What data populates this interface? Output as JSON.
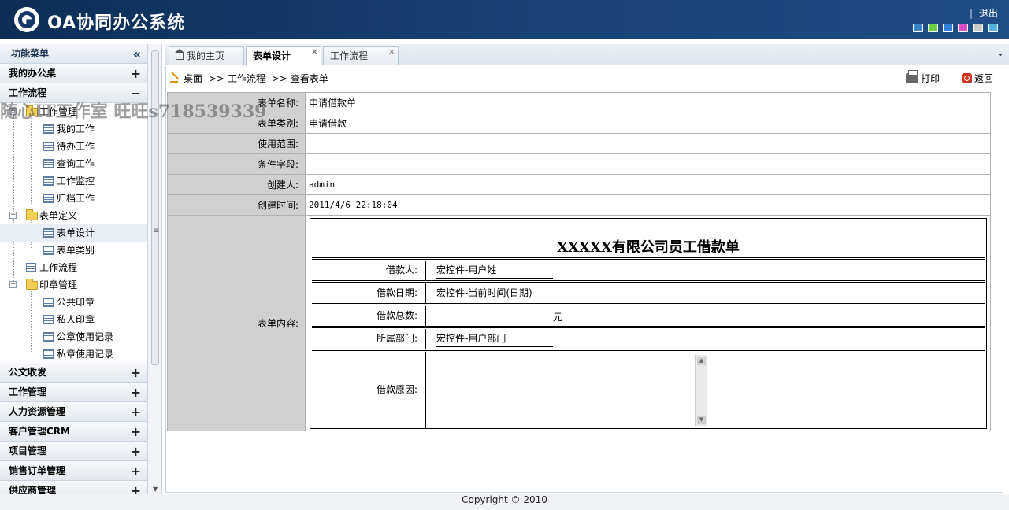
{
  "header": {
    "title": "OA协同办公系统",
    "logout": "退出",
    "swatch_colors": [
      "#3a82c9",
      "#6ccf44",
      "#2f7fd8",
      "#d64fc4",
      "#c9c9c9",
      "#4fb3e0"
    ]
  },
  "sidebar": {
    "title": "功能菜单",
    "top_categories": [
      "我的办公桌",
      "工作流程"
    ],
    "tree": {
      "g1": "工作管理",
      "g1_items": [
        "我的工作",
        "待办工作",
        "查询工作",
        "工作监控",
        "归档工作"
      ],
      "g2": "表单定义",
      "g2_items": [
        "表单设计",
        "表单类别"
      ],
      "workflow": "工作流程",
      "g3": "印章管理",
      "g3_items": [
        "公共印章",
        "私人印章",
        "公章使用记录",
        "私章使用记录"
      ]
    },
    "bottom_categories": [
      "公文收发",
      "工作管理",
      "人力资源管理",
      "客户管理CRM",
      "项目管理",
      "销售订单管理",
      "供应商管理"
    ]
  },
  "tabs": [
    "我的主页",
    "表单设计",
    "工作流程"
  ],
  "breadcrumb": {
    "desktop": "桌面",
    "sep": ">>",
    "workflow": "工作流程",
    "view": "查看表单",
    "print": "打印",
    "back": "返回"
  },
  "form": {
    "labels": [
      "表单名称:",
      "表单类别:",
      "使用范围:",
      "条件字段:",
      "创建人:",
      "创建时间:",
      "表单内容:"
    ],
    "values": [
      "申请借款单",
      "申请借款",
      "",
      "",
      "admin",
      "2011/4/6 22:18:04"
    ]
  },
  "content_form": {
    "title": "XXXXX有限公司员工借款单",
    "rows": [
      {
        "label": "借款人:",
        "value": "宏控件-用户姓"
      },
      {
        "label": "借款日期:",
        "value": "宏控件-当前时间(日期)"
      },
      {
        "label": "借款总数:",
        "value": "元"
      },
      {
        "label": "所属部门:",
        "value": "宏控件-用户部门"
      },
      {
        "label": "借款原因:",
        "value": ""
      }
    ]
  },
  "footer": "Copyright © 2010",
  "watermark": "随心IT工作室 旺旺s718539339"
}
